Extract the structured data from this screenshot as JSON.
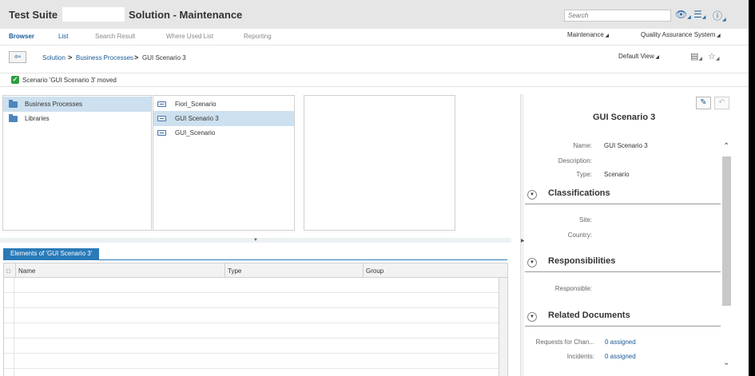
{
  "header": {
    "suite_title": "Test Suite",
    "app_title": "Solution - Maintenance",
    "search_placeholder": "Search"
  },
  "nav": {
    "tabs": [
      "Browser",
      "List",
      "Search Result",
      "Where Used List",
      "Reporting"
    ],
    "right": [
      "Maintenance",
      "Quality Assurance System"
    ]
  },
  "breadcrumb": {
    "items": [
      "Solution",
      "Business Processes"
    ],
    "separator": ">",
    "current": "GUI Scenario 3"
  },
  "toolbar": {
    "view": "Default View"
  },
  "message": {
    "text": "Scenario 'GUI Scenario 3' moved",
    "color": "#2e9e3e"
  },
  "column1": {
    "items": [
      {
        "label": "Business Processes",
        "selected": true
      },
      {
        "label": "Libraries",
        "selected": false
      }
    ]
  },
  "column2": {
    "items": [
      {
        "label": "Fiori_Scenario",
        "selected": false
      },
      {
        "label": "GUI Scenario 3",
        "selected": true
      },
      {
        "label": "GUI_Scenario",
        "selected": false
      }
    ]
  },
  "elements": {
    "tab_label": "Elements of 'GUI Scenario 3'",
    "columns": [
      "Name",
      "Type",
      "Group"
    ]
  },
  "detail": {
    "title": "GUI Scenario 3",
    "fields": [
      {
        "label": "Name:",
        "value": "GUI Scenario 3"
      },
      {
        "label": "Description:",
        "value": ""
      },
      {
        "label": "Type:",
        "value": "Scenario"
      }
    ],
    "sections": [
      {
        "title": "Classifications",
        "fields": [
          {
            "label": "Site:"
          },
          {
            "label": "Country:"
          }
        ]
      },
      {
        "title": "Responsibilities",
        "fields": [
          {
            "label": "Responsible:"
          }
        ]
      },
      {
        "title": "Related Documents",
        "fields": [
          {
            "label": "Requests for Chan...",
            "value": "0 assigned"
          },
          {
            "label": "Incidents:",
            "value": "0 assigned"
          }
        ]
      }
    ]
  },
  "colors": {
    "accent": "#2a7ab8",
    "link": "#1a5a96",
    "selection": "#cde0ef"
  }
}
